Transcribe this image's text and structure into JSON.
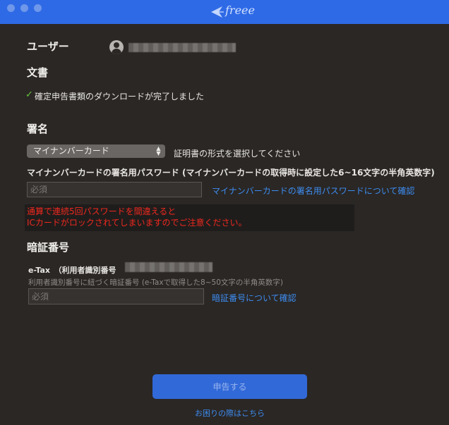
{
  "window": {
    "app_name": "freee"
  },
  "user": {
    "heading": "ユーザー",
    "icon": "user-avatar-icon"
  },
  "document": {
    "heading": "文書",
    "status_icon": "checkmark-icon",
    "status_text": "確定申告書類のダウンロードが完了しました"
  },
  "signature": {
    "heading": "署名",
    "certificate_select": {
      "selected": "マイナンバーカード",
      "hint": "証明書の形式を選択してください"
    },
    "password_label": "マイナンバーカードの署名用パスワード (マイナンバーカードの取得時に設定した6~16文字の半角英数字)",
    "password_placeholder": "必須",
    "password_help_link": "マイナンバーカードの署名用パスワードについて確認",
    "warning_line1": "通算で連続5回パスワードを間違えると",
    "warning_line2": "ICカードがロックされてしまいますのでご注意ください。"
  },
  "pin": {
    "heading": "暗証番号",
    "etax_label": "e-Tax　（利用者識別番号",
    "sub_label": "利用者識別番号に紐づく暗証番号 (e-Taxで取得した8~50文字の半角英数字)",
    "placeholder": "必須",
    "help_link": "暗証番号について確認"
  },
  "footer": {
    "submit_label": "申告する",
    "help_link": "お困りの際はこちら"
  },
  "colors": {
    "titlebar": "#2f6ae6",
    "background": "#2a2725",
    "link": "#3e8cf0",
    "warning": "#f0281e",
    "success": "#66c43a",
    "submit": "#3269d8"
  }
}
